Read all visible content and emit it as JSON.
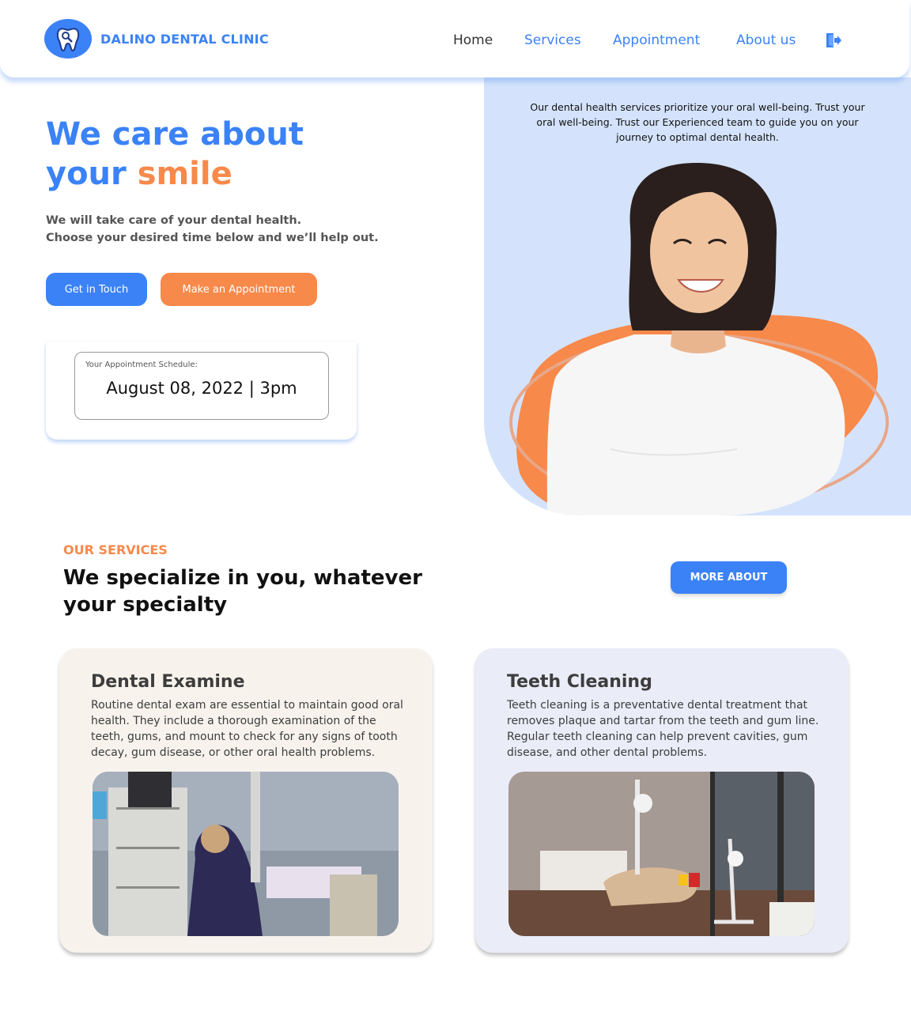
{
  "header": {
    "brand": "DALINO DENTAL CLINIC",
    "nav": {
      "home": "Home",
      "services": "Services",
      "appointment": "Appointment",
      "about": "About us"
    },
    "icons": {
      "logo": "tooth-icon",
      "logout": "logout-icon"
    }
  },
  "hero": {
    "headline_part1": "We care about",
    "headline_part2": "your ",
    "headline_accent": "smile",
    "subhead_line1": "We will take care of your dental health.",
    "subhead_line2": "Choose your desired time below and we’ll help out.",
    "buttons": {
      "touch": "Get in Touch",
      "appointment": "Make an Appointment"
    },
    "panel_text": "Our dental health services prioritize your oral well-being. Trust your oral well-being. Trust our Experienced team to guide you on your journey to optimal dental health."
  },
  "schedule": {
    "label": "Your Appointment Schedule:",
    "value": "August 08, 2022 | 3pm"
  },
  "services": {
    "kicker": "OUR SERVICES",
    "title": "We specialize in you, whatever your specialty",
    "more_button": "MORE ABOUT",
    "cards": [
      {
        "title": "Dental Examine",
        "text": "Routine dental exam are essential to maintain good oral health. They include a thorough examination of the teeth, gums, and mount to check for any signs of tooth decay, gum disease, or other oral health problems."
      },
      {
        "title": "Teeth Cleaning",
        "text": "Teeth cleaning is a preventative dental treatment that removes plaque and tartar from the teeth and gum line. Regular teeth cleaning can help prevent cavities, gum disease, and other dental problems."
      }
    ]
  },
  "colors": {
    "primary": "#3b82f6",
    "accent": "#f7894a",
    "panel": "#d4e3fb",
    "card_exam": "#f7f3ec",
    "card_clean": "#eaecf8"
  }
}
